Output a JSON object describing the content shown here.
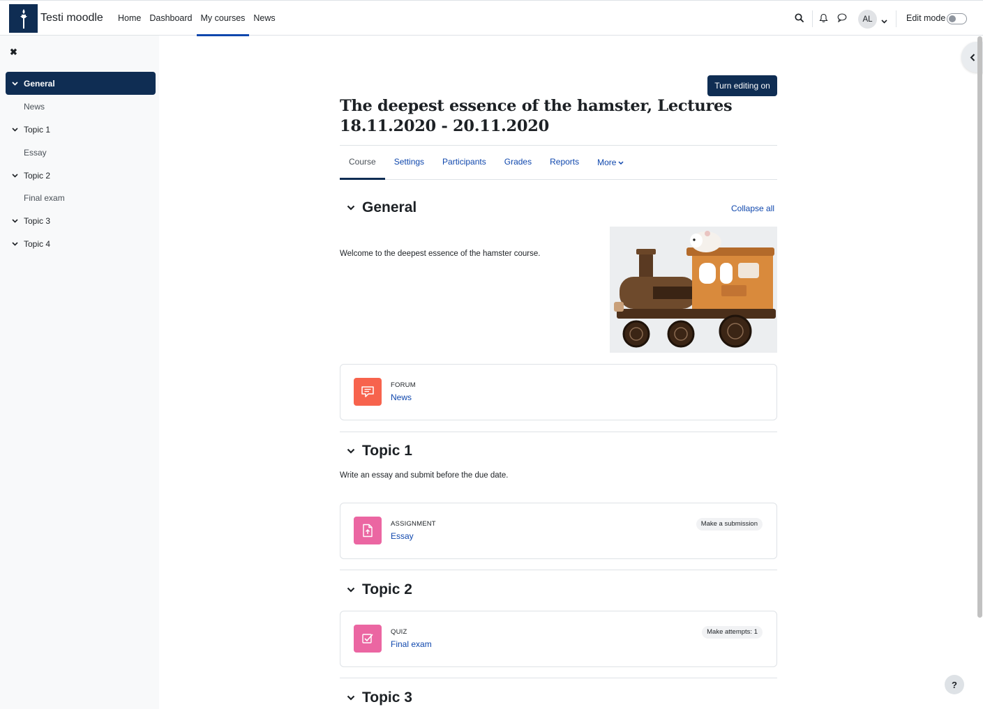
{
  "navbar": {
    "brand": "Testi moodle",
    "links": [
      "Home",
      "Dashboard",
      "My courses",
      "News"
    ],
    "active_link": "My courses",
    "avatar_initials": "AL",
    "edit_mode_label": "Edit mode"
  },
  "drawer": {
    "items": [
      {
        "label": "General",
        "type": "section",
        "active": true
      },
      {
        "label": "News",
        "type": "activity"
      },
      {
        "label": "Topic 1",
        "type": "section"
      },
      {
        "label": "Essay",
        "type": "activity"
      },
      {
        "label": "Topic 2",
        "type": "section"
      },
      {
        "label": "Final exam",
        "type": "activity"
      },
      {
        "label": "Topic 3",
        "type": "section"
      },
      {
        "label": "Topic 4",
        "type": "section"
      }
    ]
  },
  "course": {
    "turn_editing_label": "Turn editing on",
    "title": "The deepest essence of the hamster, Lectures 18.11.2020 - 20.11.2020",
    "tabs": [
      "Course",
      "Settings",
      "Participants",
      "Grades",
      "Reports",
      "More"
    ],
    "active_tab": "Course",
    "collapse_all_label": "Collapse all",
    "sections": [
      {
        "title": "General",
        "summary": "Welcome to the deepest essence of the hamster course.",
        "activities": [
          {
            "type": "Forum",
            "name": "News",
            "badge": ""
          }
        ]
      },
      {
        "title": "Topic 1",
        "summary": "Write an essay and submit before the due date.",
        "activities": [
          {
            "type": "Assignment",
            "name": "Essay",
            "badge": "Make a submission"
          }
        ]
      },
      {
        "title": "Topic 2",
        "summary": "",
        "activities": [
          {
            "type": "Quiz",
            "name": "Final exam",
            "badge": "Make attempts: 1"
          }
        ]
      },
      {
        "title": "Topic 3",
        "summary": "",
        "activities": []
      }
    ]
  },
  "help_label": "?",
  "colors": {
    "brand_navy": "#0f2d53",
    "link_blue": "#0f47ad",
    "forum_orange": "#f7634d",
    "assessment_pink": "#eb66a2"
  },
  "icons": {
    "forum": "forum-icon",
    "assignment": "assignment-icon",
    "quiz": "quiz-icon"
  }
}
